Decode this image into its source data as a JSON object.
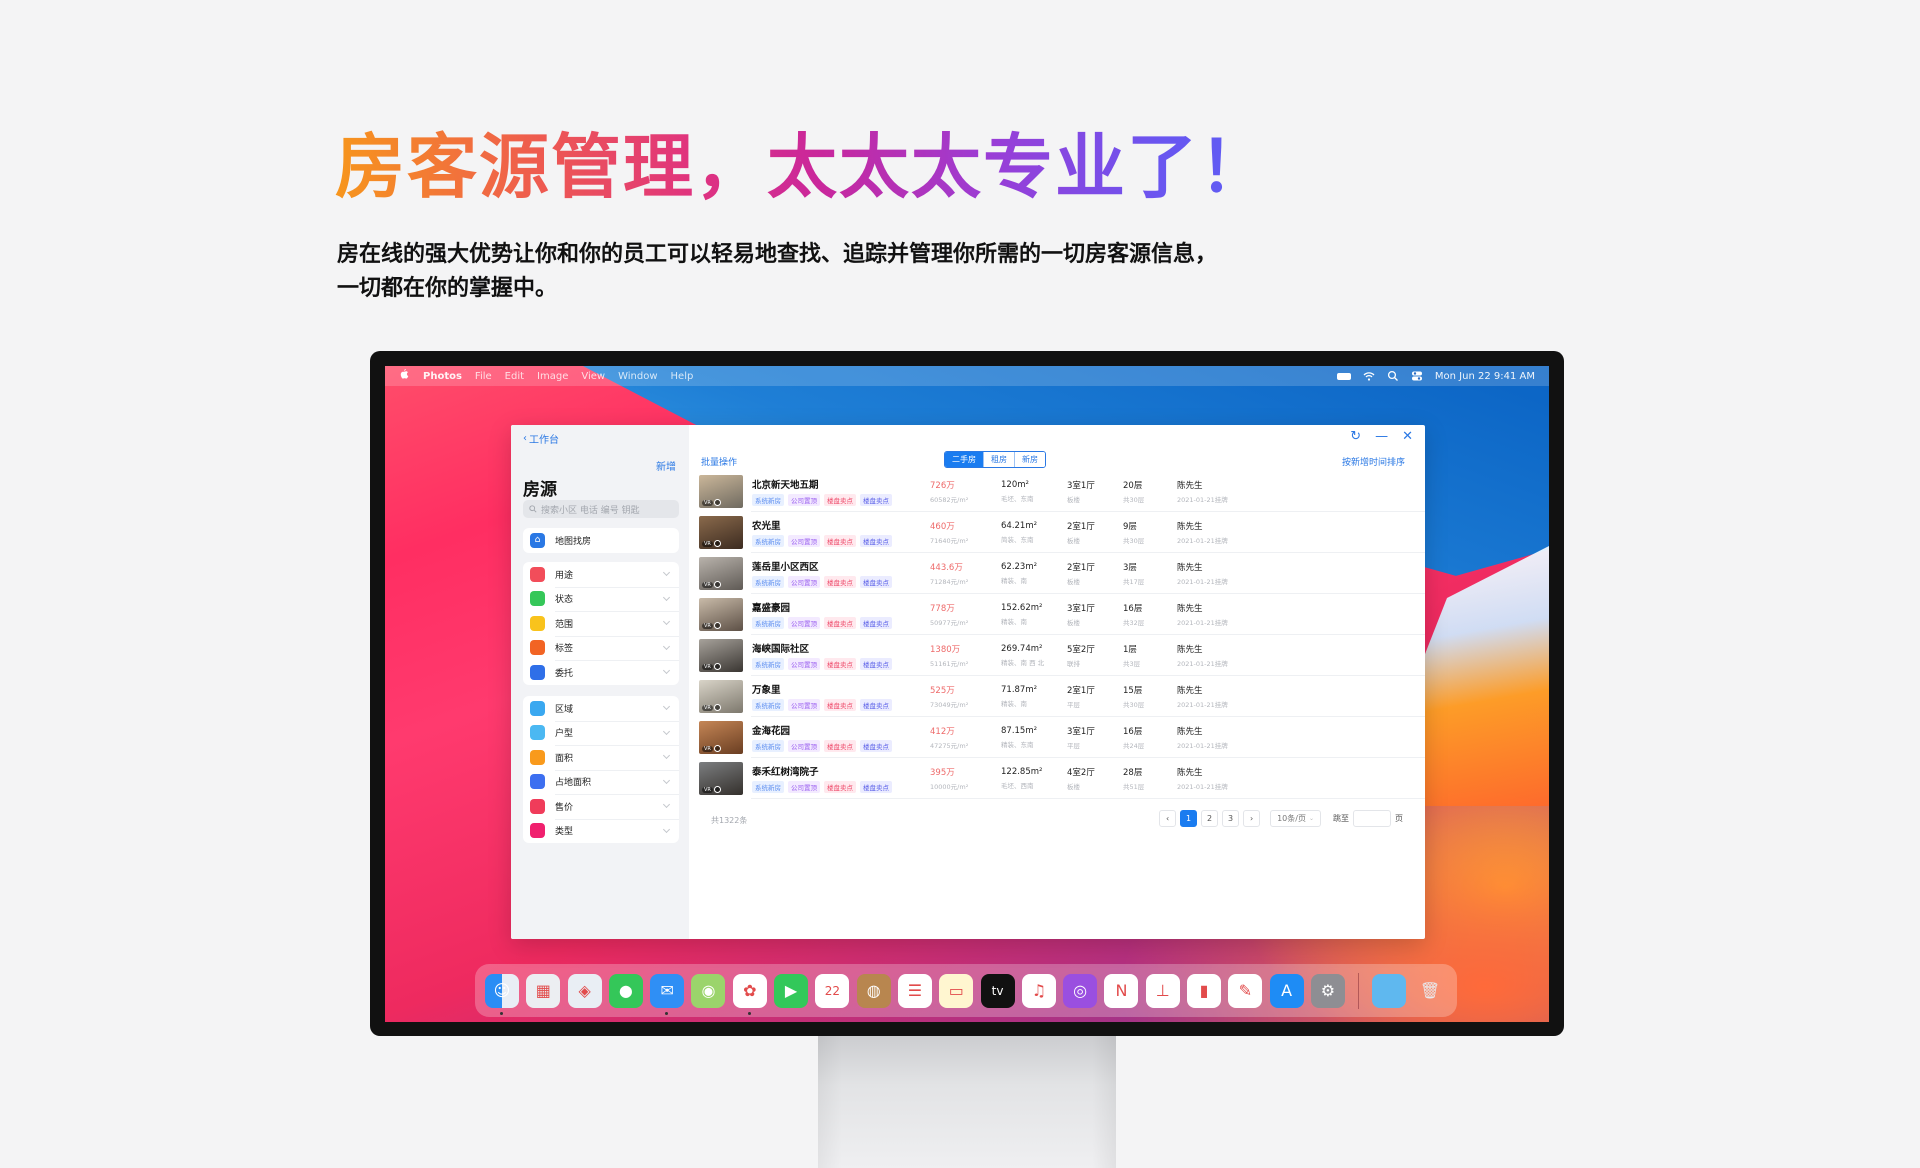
{
  "hero": {
    "headline": "房客源管理，太太太专业了！",
    "subline_1": "房在线的强大优势让你和你的员工可以轻易地查找、追踪并管理你所需的一切房客源信息，",
    "subline_2": "一切都在你的掌握中。"
  },
  "menubar": {
    "apple_icon": "apple-logo-icon",
    "app_name": "Photos",
    "menus": [
      "File",
      "Edit",
      "Image",
      "View",
      "Window",
      "Help"
    ],
    "status_icons": [
      "battery-icon",
      "wifi-icon",
      "search-icon",
      "control-center-icon"
    ],
    "clock": "Mon Jun 22  9:41 AM"
  },
  "app": {
    "back_label": "工作台",
    "new_label": "新增",
    "sidebar_title": "房源",
    "search_placeholder": "搜索小区 电话 编号 钥匙",
    "map_search": {
      "label": "地图找房",
      "icon": "map-person-icon",
      "color": "#2a78e4"
    },
    "filters_group_1": [
      {
        "label": "用途",
        "icon": "leaf-icon",
        "color": "#f24d5a"
      },
      {
        "label": "状态",
        "icon": "trend-icon",
        "color": "#35c759"
      },
      {
        "label": "范围",
        "icon": "target-icon",
        "color": "#f9c31c"
      },
      {
        "label": "标签",
        "icon": "tag-icon",
        "color": "#f26424"
      },
      {
        "label": "委托",
        "icon": "handshake-icon",
        "color": "#2f6fe8"
      }
    ],
    "filters_group_2": [
      {
        "label": "区域",
        "icon": "location-arrow-icon",
        "color": "#3aa8f0"
      },
      {
        "label": "户型",
        "icon": "layout-icon",
        "color": "#4bb8f2"
      },
      {
        "label": "面积",
        "icon": "pie-icon",
        "color": "#f99a1c"
      },
      {
        "label": "占地面积",
        "icon": "stripes-icon",
        "color": "#3d6ff0"
      },
      {
        "label": "售价",
        "icon": "card-icon",
        "color": "#f03c5a"
      },
      {
        "label": "类型",
        "icon": "layers-icon",
        "color": "#f0206e"
      }
    ],
    "window_controls": [
      "refresh-icon",
      "minimize-icon",
      "close-icon"
    ],
    "batch_label": "批量操作",
    "segments": [
      {
        "label": "二手房",
        "active": true
      },
      {
        "label": "租房",
        "active": false
      },
      {
        "label": "新房",
        "active": false
      }
    ],
    "sort_label": "按新增时间排序",
    "tags": [
      "系统新房",
      "公司置顶",
      "楼盘卖点",
      "楼盘卖点"
    ],
    "listings": [
      {
        "name": "北京新天地五期",
        "price": "726万",
        "unit_price": "60582元/m²",
        "area": "120m²",
        "decor": "毛坯、东南",
        "rooms": "3室1厅",
        "build": "板楼",
        "floor": "20层",
        "total_floors": "共30层",
        "agent": "陈先生",
        "listed": "2021-01-21挂牌",
        "thumb": [
          "#cbb79a",
          "#6f6a60"
        ]
      },
      {
        "name": "农光里",
        "price": "460万",
        "unit_price": "71640元/m²",
        "area": "64.21m²",
        "decor": "简装、东南",
        "rooms": "2室1厅",
        "build": "板楼",
        "floor": "9层",
        "total_floors": "共30层",
        "agent": "陈先生",
        "listed": "2021-01-21挂牌",
        "thumb": [
          "#8a6a4c",
          "#3c2b20"
        ]
      },
      {
        "name": "莲岳里小区西区",
        "price": "443.6万",
        "unit_price": "71284元/m²",
        "area": "62.23m²",
        "decor": "精装、南",
        "rooms": "2室1厅",
        "build": "板楼",
        "floor": "3层",
        "total_floors": "共17层",
        "agent": "陈先生",
        "listed": "2021-01-21挂牌",
        "thumb": [
          "#b9b3ac",
          "#5f5a55"
        ]
      },
      {
        "name": "嘉盛豪园",
        "price": "778万",
        "unit_price": "50977元/m²",
        "area": "152.62m²",
        "decor": "精装、南",
        "rooms": "3室1厅",
        "build": "板楼",
        "floor": "16层",
        "total_floors": "共32层",
        "agent": "陈先生",
        "listed": "2021-01-21挂牌",
        "thumb": [
          "#c9bba9",
          "#5d5046"
        ]
      },
      {
        "name": "海峡国际社区",
        "price": "1380万",
        "unit_price": "51161元/m²",
        "area": "269.74m²",
        "decor": "精装、南 西 北",
        "rooms": "5室2厅",
        "build": "联排",
        "floor": "1层",
        "total_floors": "共3层",
        "agent": "陈先生",
        "listed": "2021-01-21挂牌",
        "thumb": [
          "#a7a29b",
          "#3a3632"
        ]
      },
      {
        "name": "万象里",
        "price": "525万",
        "unit_price": "73049元/m²",
        "area": "71.87m²",
        "decor": "精装、南",
        "rooms": "2室1厅",
        "build": "平层",
        "floor": "15层",
        "total_floors": "共30层",
        "agent": "陈先生",
        "listed": "2021-01-21挂牌",
        "thumb": [
          "#d9d4c8",
          "#7d786d"
        ]
      },
      {
        "name": "金海花园",
        "price": "412万",
        "unit_price": "47275元/m²",
        "area": "87.15m²",
        "decor": "精装、东南",
        "rooms": "3室1厅",
        "build": "平层",
        "floor": "16层",
        "total_floors": "共24层",
        "agent": "陈先生",
        "listed": "2021-01-21挂牌",
        "thumb": [
          "#c58656",
          "#6a3e22"
        ]
      },
      {
        "name": "泰禾红树湾院子",
        "price": "395万",
        "unit_price": "10000元/m²",
        "area": "122.85m²",
        "decor": "毛坯、西南",
        "rooms": "4室2厅",
        "build": "板楼",
        "floor": "28层",
        "total_floors": "共51层",
        "agent": "陈先生",
        "listed": "2021-01-21挂牌",
        "thumb": [
          "#7c7e80",
          "#34302c"
        ]
      }
    ],
    "pagination": {
      "total": "共1322条",
      "pages": [
        "1",
        "2",
        "3"
      ],
      "current": "1",
      "page_size": "10条/页",
      "jump_label": "跳至",
      "jump_value": "",
      "page_word": "页"
    }
  },
  "dock": {
    "apps": [
      {
        "name": "finder-icon",
        "bg": "linear-gradient(90deg,#2a8df5 50%,#e9eef5 50%)",
        "glyph": "☺",
        "running": true
      },
      {
        "name": "launchpad-icon",
        "bg": "#eceef2",
        "glyph": "▦",
        "running": false
      },
      {
        "name": "safari-icon",
        "bg": "#e9eef4",
        "glyph": "◈",
        "running": false
      },
      {
        "name": "messages-icon",
        "bg": "#34c759",
        "glyph": "●",
        "running": false
      },
      {
        "name": "mail-icon",
        "bg": "#2f8ff5",
        "glyph": "✉",
        "running": true
      },
      {
        "name": "maps-icon",
        "bg": "#9bd46b",
        "glyph": "◉",
        "running": false
      },
      {
        "name": "photos-icon",
        "bg": "#ffffff",
        "glyph": "✿",
        "running": true
      },
      {
        "name": "facetime-icon",
        "bg": "#32c85a",
        "glyph": "▶",
        "running": false
      },
      {
        "name": "calendar-icon",
        "bg": "#ffffff",
        "glyph": "22",
        "running": false
      },
      {
        "name": "contacts-icon",
        "bg": "#b8864f",
        "glyph": "◍",
        "running": false
      },
      {
        "name": "reminders-icon",
        "bg": "#ffffff",
        "glyph": "☰",
        "running": false
      },
      {
        "name": "notes-icon",
        "bg": "#fff6d0",
        "glyph": "▭",
        "running": false
      },
      {
        "name": "apple-tv-icon",
        "bg": "#111111",
        "glyph": "tv",
        "running": false
      },
      {
        "name": "music-icon",
        "bg": "#ffffff",
        "glyph": "♫",
        "running": false
      },
      {
        "name": "podcasts-icon",
        "bg": "#9a4fe0",
        "glyph": "◎",
        "running": false
      },
      {
        "name": "news-icon",
        "bg": "#ffffff",
        "glyph": "N",
        "running": false
      },
      {
        "name": "keynote-icon",
        "bg": "#ffffff",
        "glyph": "⊥",
        "running": false
      },
      {
        "name": "numbers-icon",
        "bg": "#ffffff",
        "glyph": "▮",
        "running": false
      },
      {
        "name": "pages-icon",
        "bg": "#ffffff",
        "glyph": "✎",
        "running": false
      },
      {
        "name": "app-store-icon",
        "bg": "#1e8cf5",
        "glyph": "A",
        "running": false
      },
      {
        "name": "system-preferences-icon",
        "bg": "#8e8e93",
        "glyph": "⚙",
        "running": false
      }
    ],
    "trailing": [
      {
        "name": "folder-icon",
        "bg": "#5fb8ef",
        "glyph": ""
      },
      {
        "name": "trash-icon",
        "bg": "rgba(255,255,255,0.0)",
        "glyph": "🗑"
      }
    ]
  }
}
